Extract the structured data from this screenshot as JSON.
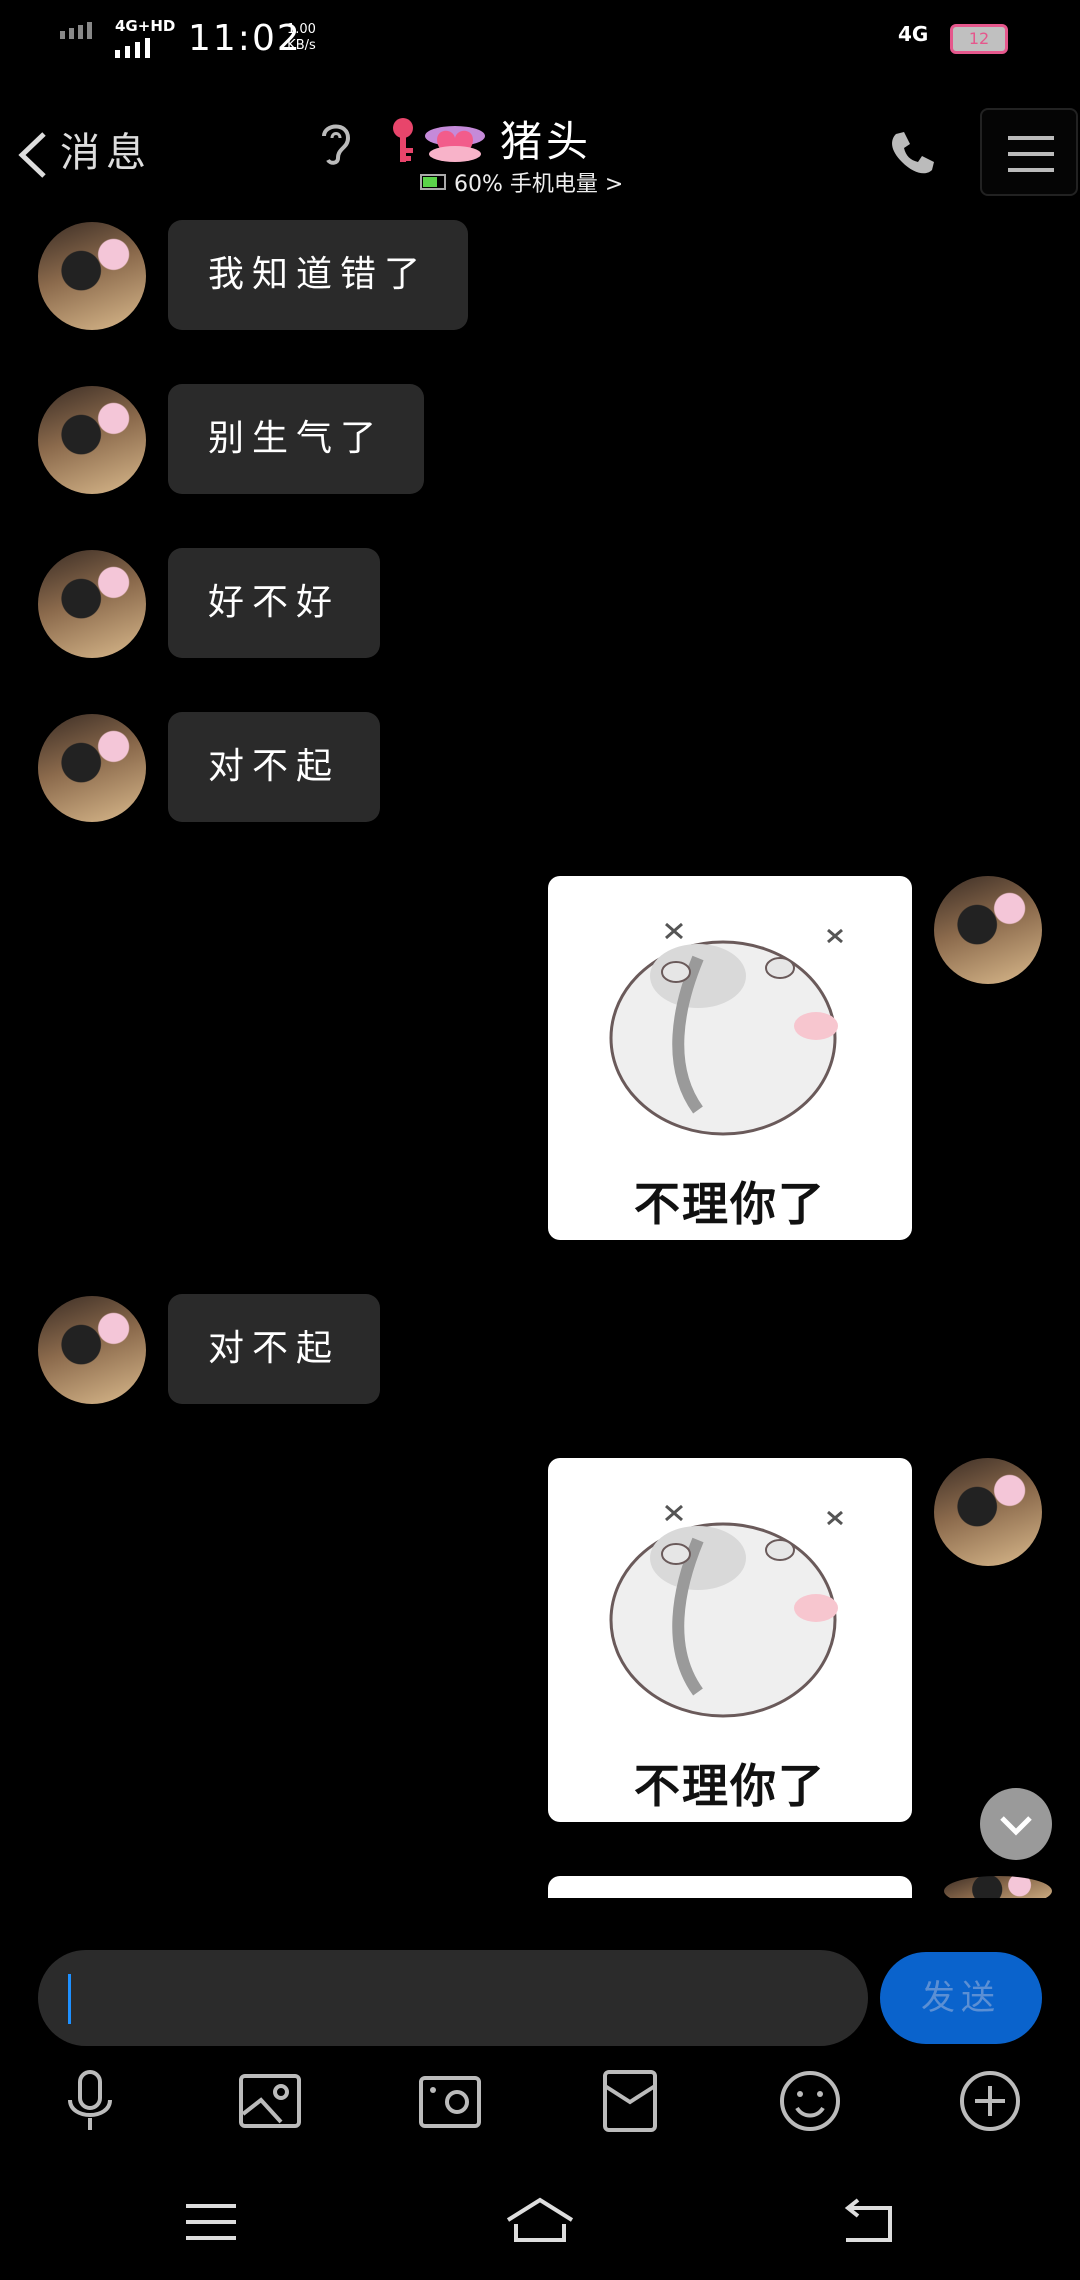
{
  "status_bar": {
    "network_left": "4G+HD",
    "time": "11:02",
    "speed_value": "1.00",
    "speed_unit": "KB/s",
    "network_right": "4G",
    "battery": "12"
  },
  "header": {
    "back_label": "消息",
    "contact_name": "猪头",
    "subtitle": "60% 手机电量 >"
  },
  "messages": [
    {
      "side": "left",
      "type": "text",
      "text": "我知道错了"
    },
    {
      "side": "left",
      "type": "text",
      "text": "别生气了"
    },
    {
      "side": "left",
      "type": "text",
      "text": "好不好"
    },
    {
      "side": "left",
      "type": "text",
      "text": "对不起"
    },
    {
      "side": "right",
      "type": "sticker",
      "caption": "不理你了"
    },
    {
      "side": "left",
      "type": "text",
      "text": "对不起"
    },
    {
      "side": "right",
      "type": "sticker",
      "caption": "不理你了"
    }
  ],
  "composer": {
    "input_value": "",
    "send_label": "发送"
  },
  "toolbar_icons": [
    "microphone-icon",
    "image-icon",
    "camera-icon",
    "red-packet-icon",
    "emoji-icon",
    "plus-icon"
  ],
  "colors": {
    "accent": "#0a63cc",
    "bubble": "#2a2a2a",
    "background": "#000000",
    "battery_border": "#e5578c"
  }
}
